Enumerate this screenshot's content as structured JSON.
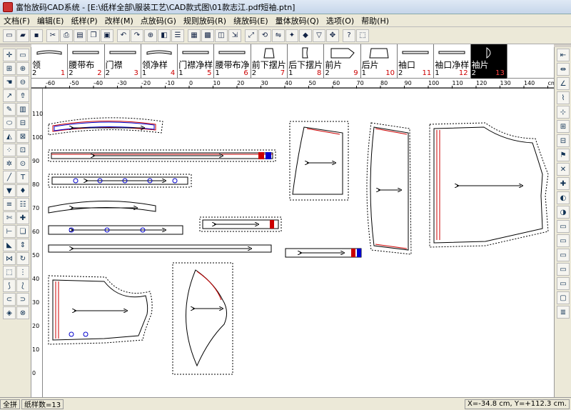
{
  "title": "富怡放码CAD系统 - [E:\\纸样全部\\服装工艺\\CAD款式图\\01款志江.pdf短袖.ptn]",
  "menu": [
    "文档(F)",
    "编辑(E)",
    "纸样(P)",
    "改样(M)",
    "点放码(G)",
    "规则放码(R)",
    "绕放码(E)",
    "量体放码(Q)",
    "选项(O)",
    "帮助(H)"
  ],
  "toolbar": [
    "new-file-icon",
    "open-icon",
    "save-icon",
    "cut-icon",
    "print-icon",
    "plot-icon",
    "copy-icon",
    "paste-icon",
    "undo-icon",
    "redo-icon",
    "zoom-icon",
    "piece-icon",
    "piece-list-icon",
    "table-icon",
    "grid-icon",
    "layout-icon",
    "export-icon",
    "fit-icon",
    "rotate-icon",
    "flip-icon",
    "grade-icon",
    "mark-icon",
    "notch-icon",
    "measure-icon",
    "help-icon"
  ],
  "pieces": [
    {
      "name": "领",
      "count": "2",
      "index": "1"
    },
    {
      "name": "腰带布",
      "count": "2",
      "index": "2"
    },
    {
      "name": "门襟",
      "count": "2",
      "index": "3"
    },
    {
      "name": "领净样",
      "count": "1",
      "index": "4"
    },
    {
      "name": "门襟净样",
      "count": "1",
      "index": "5"
    },
    {
      "name": "腰带布净",
      "count": "1",
      "index": "6"
    },
    {
      "name": "前下摆片",
      "count": "2",
      "index": "7"
    },
    {
      "name": "后下摆片",
      "count": "1",
      "index": "8"
    },
    {
      "name": "前片",
      "count": "2",
      "index": "9"
    },
    {
      "name": "后片",
      "count": "1",
      "index": "10"
    },
    {
      "name": "袖口",
      "count": "2",
      "index": "11"
    },
    {
      "name": "袖口净样",
      "count": "1",
      "index": "12"
    },
    {
      "name": "袖片",
      "count": "2",
      "index": "13"
    }
  ],
  "ruler_top": [
    "-60",
    "-50",
    "-40",
    "-30",
    "-20",
    "-10",
    "0",
    "10",
    "20",
    "30",
    "40",
    "50",
    "60",
    "70",
    "80",
    "90",
    "100",
    "110",
    "120",
    "130",
    "140",
    "cm"
  ],
  "ruler_left": [
    "110",
    "100",
    "90",
    "80",
    "70",
    "60",
    "50",
    "40",
    "30",
    "20",
    "10",
    "0"
  ],
  "status": {
    "mode": "全拼",
    "piece_count": "纸样数=13",
    "coords": "X=-34.8 cm, Y=+112.3 cm."
  }
}
